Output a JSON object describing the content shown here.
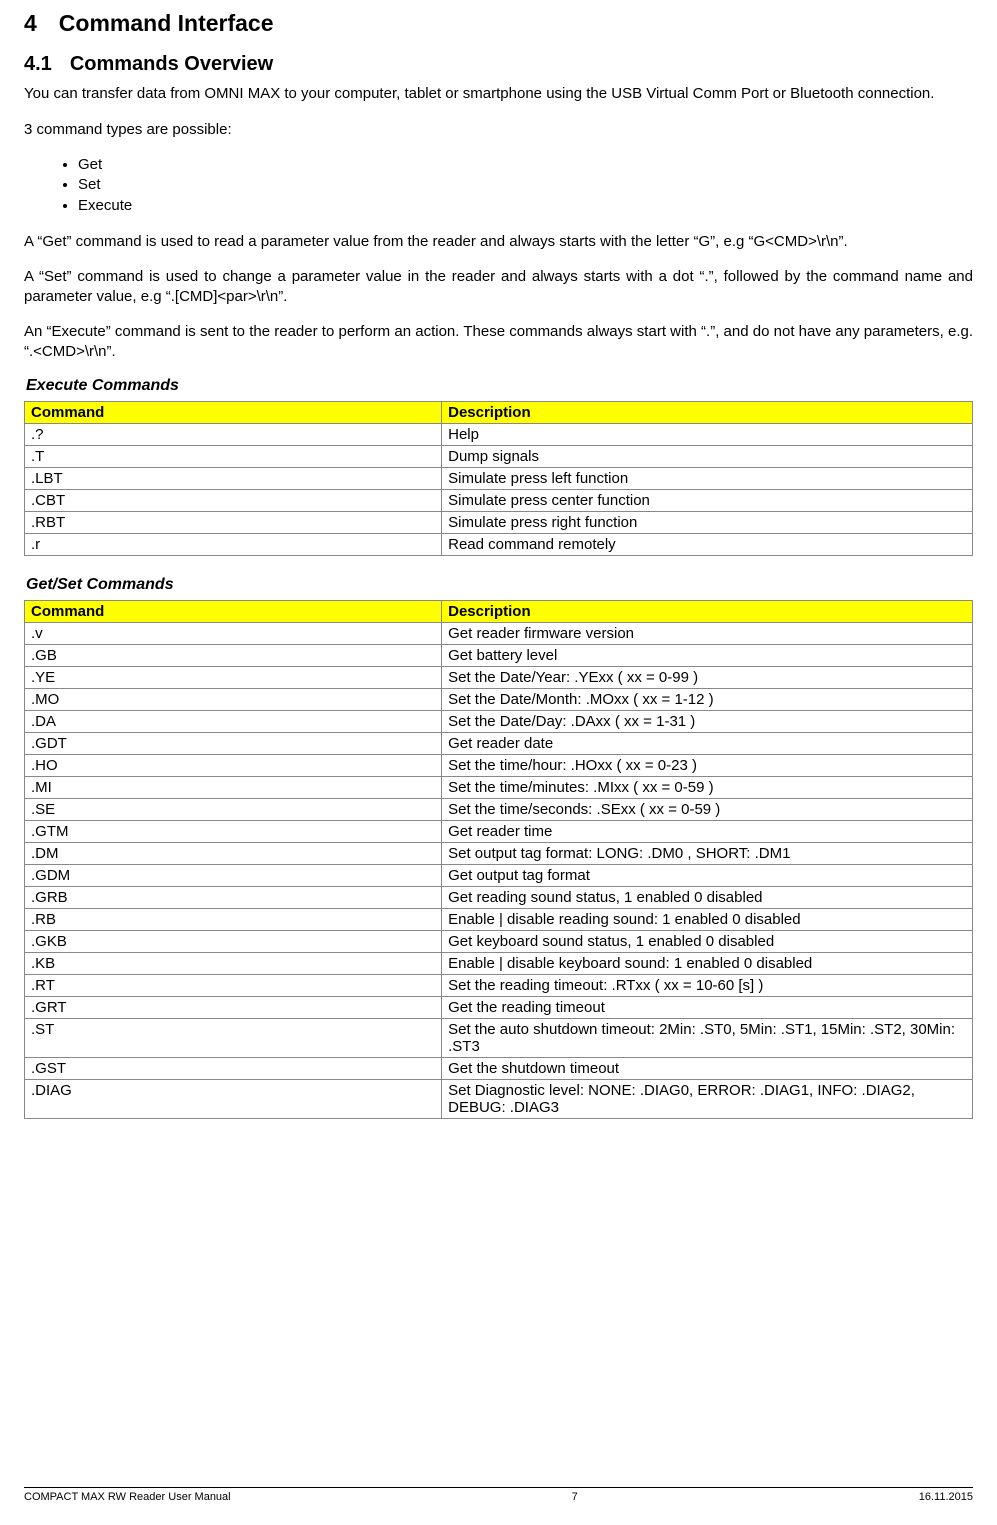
{
  "section": {
    "number": "4",
    "title": "Command Interface"
  },
  "subsection": {
    "number": "4.1",
    "title": "Commands Overview"
  },
  "paragraphs": {
    "p1": "You can transfer data from OMNI MAX to your computer, tablet or smartphone using the USB Virtual Comm Port or Bluetooth connection.",
    "p2": "3 command types are possible:",
    "p3": "A “Get” command is used to read a parameter value from the reader and always starts with the letter “G”, e.g “G<CMD>\\r\\n”.",
    "p4": "A “Set” command is used to change a parameter value in the reader and always starts with a dot “.”, followed by the command name and parameter value, e.g “.[CMD]<par>\\r\\n”.",
    "p5": "An “Execute” command is sent to the reader to perform an action. These commands always start with “.”, and do not have any parameters, e.g. “.<CMD>\\r\\n”."
  },
  "bullets": [
    "Get",
    "Set",
    "Execute"
  ],
  "execTable": {
    "title": "Execute Commands",
    "headers": [
      "Command",
      "Description"
    ],
    "rows": [
      [
        ".?",
        "Help"
      ],
      [
        ".T",
        "Dump signals"
      ],
      [
        ".LBT",
        "Simulate press left function"
      ],
      [
        ".CBT",
        "Simulate press center function"
      ],
      [
        ".RBT",
        "Simulate press right function"
      ],
      [
        ".r",
        "Read command remotely"
      ]
    ]
  },
  "getsetTable": {
    "title": "Get/Set Commands",
    "headers": [
      "Command",
      "Description"
    ],
    "rows": [
      [
        ".v",
        "Get reader firmware version"
      ],
      [
        ".GB",
        "Get battery level"
      ],
      [
        ".YE",
        "Set the Date/Year: .YExx ( xx = 0-99 )"
      ],
      [
        ".MO",
        "Set the Date/Month: .MOxx ( xx = 1-12 )"
      ],
      [
        ".DA",
        "Set the Date/Day: .DAxx ( xx = 1-31 )"
      ],
      [
        ".GDT",
        "Get reader date"
      ],
      [
        ".HO",
        "Set the time/hour: .HOxx ( xx = 0-23 )"
      ],
      [
        ".MI",
        "Set the time/minutes: .MIxx ( xx = 0-59 )"
      ],
      [
        ".SE",
        "Set the time/seconds: .SExx ( xx = 0-59 )"
      ],
      [
        ".GTM",
        "Get reader time"
      ],
      [
        ".DM",
        "Set output tag format: LONG: .DM0 , SHORT: .DM1"
      ],
      [
        ".GDM",
        "Get output tag format"
      ],
      [
        ".GRB",
        "Get reading sound status, 1 enabled 0 disabled"
      ],
      [
        ".RB",
        "Enable | disable reading sound: 1 enabled 0 disabled"
      ],
      [
        ".GKB",
        "Get keyboard sound status, 1 enabled 0 disabled"
      ],
      [
        ".KB",
        "Enable | disable keyboard sound: 1 enabled 0 disabled"
      ],
      [
        ".RT",
        "Set the reading timeout: .RTxx ( xx = 10-60 [s] )"
      ],
      [
        ".GRT",
        "Get the reading timeout"
      ],
      [
        ".ST",
        "Set the auto shutdown timeout: 2Min: .ST0, 5Min: .ST1, 15Min: .ST2, 30Min: .ST3"
      ],
      [
        ".GST",
        "Get the shutdown timeout"
      ],
      [
        ".DIAG",
        "Set Diagnostic level: NONE: .DIAG0, ERROR: .DIAG1, INFO: .DIAG2, DEBUG: .DIAG3"
      ]
    ]
  },
  "footer": {
    "left": "COMPACT MAX RW Reader User Manual",
    "center": "7",
    "right": "16.11.2015"
  }
}
